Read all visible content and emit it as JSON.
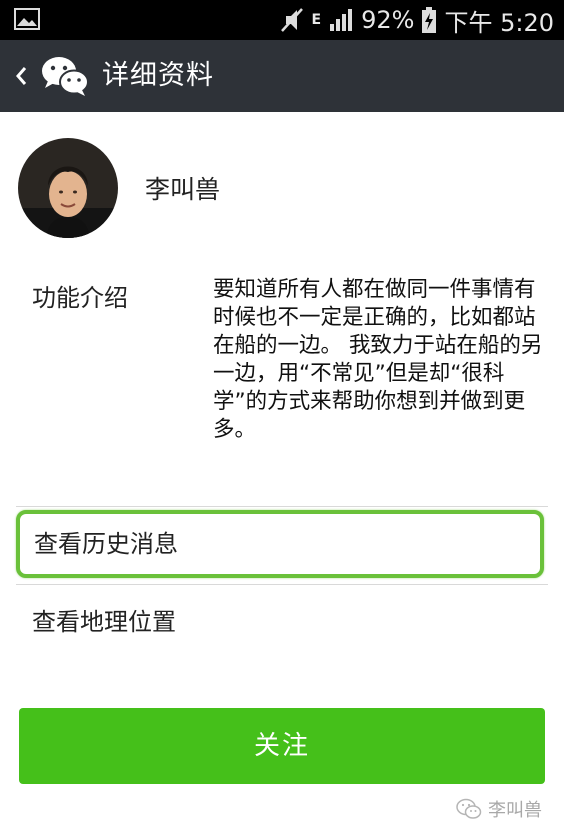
{
  "status_bar": {
    "battery": "92%",
    "time": "下午 5:20",
    "network": "E",
    "icons": [
      "gallery-icon",
      "mute-icon",
      "signal-icon",
      "battery-charging-icon"
    ]
  },
  "header": {
    "title": "详细资料",
    "back_icon": "chevron-left-icon",
    "logo": "wechat-logo"
  },
  "profile": {
    "name": "李叫兽",
    "intro_label": "功能介绍",
    "intro_text": "要知道所有人都在做同一件事情有时候也不一定是正确的，比如都站在船的一边。 我致力于站在船的另一边，用“不常见”但是却“很科学”的方式来帮助你想到并做到更多。"
  },
  "rows": {
    "history": "查看历史消息",
    "location": "查看地理位置"
  },
  "follow_button": "关注",
  "watermark": "李叫兽",
  "colors": {
    "title_bar": "#2e3238",
    "accent_green": "#45c01a",
    "highlight_border": "#6ac13a"
  }
}
